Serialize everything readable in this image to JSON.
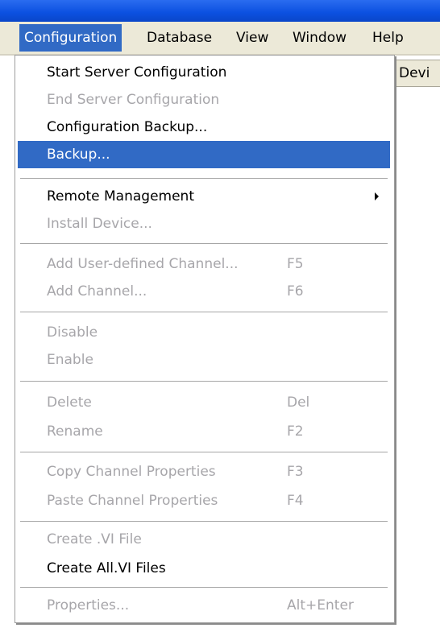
{
  "menubar": {
    "items": [
      {
        "label": "Configuration",
        "active": true
      },
      {
        "label": "Database"
      },
      {
        "label": "View"
      },
      {
        "label": "Window"
      },
      {
        "label": "Help"
      }
    ]
  },
  "background": {
    "column_header": "Devi"
  },
  "dropdown": {
    "items": [
      {
        "label": "Start Server Configuration",
        "enabled": true
      },
      {
        "label": "End Server Configuration",
        "enabled": false
      },
      {
        "label": "Configuration Backup...",
        "enabled": true
      },
      {
        "label": "Backup...",
        "enabled": true,
        "highlighted": true
      },
      {
        "label": "Remote Management",
        "enabled": true,
        "submenu": true
      },
      {
        "label": "Install Device...",
        "enabled": false
      },
      {
        "label": "Add User-defined Channel...",
        "shortcut": "F5",
        "enabled": false
      },
      {
        "label": "Add Channel...",
        "shortcut": "F6",
        "enabled": false
      },
      {
        "label": "Disable",
        "enabled": false
      },
      {
        "label": "Enable",
        "enabled": false
      },
      {
        "label": "Delete",
        "shortcut": "Del",
        "enabled": false
      },
      {
        "label": "Rename",
        "shortcut": "F2",
        "enabled": false
      },
      {
        "label": "Copy Channel Properties",
        "shortcut": "F3",
        "enabled": false
      },
      {
        "label": "Paste Channel Properties",
        "shortcut": "F4",
        "enabled": false
      },
      {
        "label": "Create .VI File",
        "enabled": false
      },
      {
        "label": "Create All.VI Files",
        "enabled": true
      },
      {
        "label": "Properties...",
        "shortcut": "Alt+Enter",
        "enabled": false
      }
    ]
  },
  "colors": {
    "highlight": "#316ac5",
    "disabled_text": "#a7a6aa",
    "menubar_bg": "#ece9d8",
    "titlebar": "#0b50e0"
  }
}
